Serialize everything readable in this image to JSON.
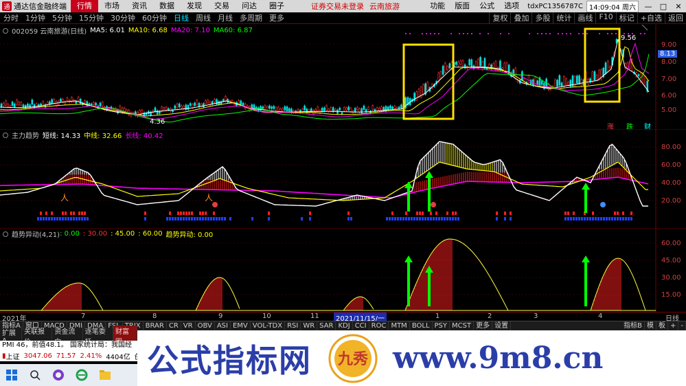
{
  "titlebar": {
    "app_title": "通达信金融终端",
    "menus": [
      "行情",
      "市场",
      "资讯",
      "数据",
      "发现",
      "交易",
      "问达",
      "圈子"
    ],
    "notice_left": "证券交易未登录",
    "notice_right": "云南旅游",
    "right_menus": [
      "功能",
      "版面",
      "公式",
      "选项"
    ],
    "account": "tdxPC1356787C",
    "datetime": "14:09:04 周六",
    "win_buttons": [
      "—",
      "□",
      "✕"
    ]
  },
  "periodbar": {
    "periods": [
      "分时",
      "1分钟",
      "5分钟",
      "15分钟",
      "30分钟",
      "60分钟",
      "日线",
      "周线",
      "月线",
      "多周期",
      "更多"
    ],
    "active_period": "日线",
    "controls": [
      "复权",
      "叠加",
      "多股",
      "统计",
      "画线",
      "F10",
      "标记",
      "+自选",
      "返回"
    ]
  },
  "main_pane": {
    "stock": "002059 云南旅游(日线)",
    "ma_labels": [
      {
        "text": "MA5: 6.01",
        "color": "#ffffff"
      },
      {
        "text": "MA10: 6.68",
        "color": "#ffff00"
      },
      {
        "text": "MA20: 7.10",
        "color": "#ff00ff"
      },
      {
        "text": "MA60: 6.87",
        "color": "#00ff00"
      }
    ],
    "price_ticks": [
      "9.00",
      "8.00",
      "7.00",
      "6.00",
      "5.00"
    ],
    "current_price": "8.13",
    "high_label": "9.56",
    "low_label": "4.36",
    "buttons": [
      "涨",
      "跌",
      "财"
    ]
  },
  "trend_pane": {
    "title": "主力趋势",
    "values": [
      {
        "text": "短线: 14.33",
        "color": "#ffffff"
      },
      {
        "text": "中线: 32.66",
        "color": "#ffff00"
      },
      {
        "text": "长线: 40.42",
        "color": "#ff00ff"
      }
    ],
    "ticks": [
      "80.00",
      "60.00",
      "40.00",
      "20.00"
    ]
  },
  "trend_move_pane": {
    "title": "趋势异动(4,21)",
    "values": [
      {
        "text": ": 0.00",
        "color": "#00ff00"
      },
      {
        "text": ": 30.00",
        "color": "#ff3030"
      },
      {
        "text": ": 45.00",
        "color": "#ffff00"
      },
      {
        "text": ": 60.00",
        "color": "#ffff00"
      },
      {
        "text": "趋势异动: 0.00",
        "color": "#ffff00"
      }
    ],
    "ticks": [
      "60.00",
      "45.00",
      "30.00",
      "15.00"
    ]
  },
  "date_axis": {
    "labels": [
      "2021年",
      "7",
      "8",
      "9",
      "10",
      "11",
      "1",
      "2",
      "3",
      "4"
    ],
    "cursor_date": "2021/11/15/一",
    "period": "日线"
  },
  "indicator_tabs": [
    "指标A",
    "窗口",
    "MACD",
    "DMI",
    "DMA",
    "FSL",
    "TRIX",
    "BRAR",
    "CR",
    "VR",
    "OBV",
    "ASI",
    "EMV",
    "VOL-TDX",
    "RSI",
    "WR",
    "SAR",
    "KDJ",
    "CCI",
    "ROC",
    "MTM",
    "BOLL",
    "PSY",
    "MCST",
    "更多",
    "设置"
  ],
  "indicator_right": [
    "指标B",
    "模",
    "板",
    "+",
    "-"
  ],
  "info_tabs": [
    "扩展A",
    "关联报价",
    "资金流向",
    "逐笔委托",
    "财富圈"
  ],
  "news": "PMI 46，前值48.1。  国家统计局：我国经",
  "quote": {
    "name": "上证",
    "price": "3047.06",
    "change": "71.57",
    "pct": "2.41%",
    "amount": "4404亿",
    "extra": "创业"
  },
  "watermark": {
    "title": "公式指标网",
    "url": "www.9m8.cn",
    "logo_text": "九秀"
  },
  "colors": {
    "up": "#ff3030",
    "down": "#00ffff",
    "highlight_box": "#ffe000",
    "signal_arrow": "#00ff00"
  }
}
